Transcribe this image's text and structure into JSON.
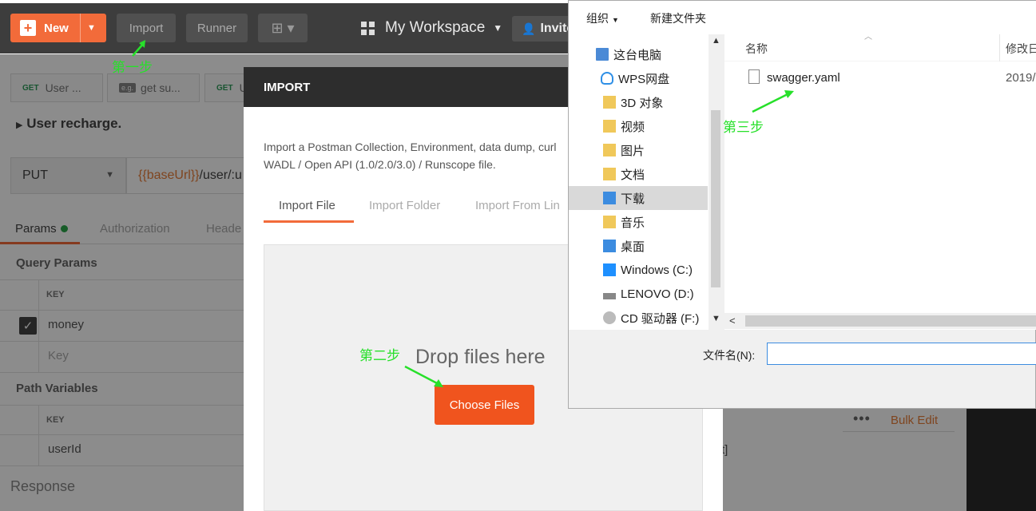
{
  "postman": {
    "new_label": "New",
    "import_label": "Import",
    "runner_label": "Runner",
    "workspace_label": "My Workspace",
    "invite_label": "Invite",
    "tabs": [
      {
        "method": "GET",
        "label": "User ..."
      },
      {
        "method": "e.g.",
        "label": "get su..."
      },
      {
        "method": "GET",
        "label": "U"
      }
    ],
    "request_name": "User recharge.",
    "method": "PUT",
    "url_var": "{{baseUrl}}",
    "url_rest": "/user/:u",
    "param_tabs": [
      "Params",
      "Authorization",
      "Heade"
    ],
    "query_params_title": "Query Params",
    "key_header": "KEY",
    "query_rows": [
      "money",
      "Key"
    ],
    "path_vars_title": "Path Variables",
    "path_rows": [
      "userId"
    ],
    "response_label": "Response",
    "bulk_edit": "Bulk Edit",
    "more_dots": "•••",
    "bracket_text": "t]"
  },
  "annotations": {
    "step1": "第一步",
    "step2": "第二步",
    "step3": "第三步"
  },
  "import_modal": {
    "title": "IMPORT",
    "description": "Import a Postman Collection, Environment, data dump, curl WADL / Open API (1.0/2.0/3.0) / Runscope file.",
    "tabs": [
      "Import File",
      "Import Folder",
      "Import From Lin"
    ],
    "drop_text": "Drop files here",
    "choose_label": "Choose Files"
  },
  "file_dialog": {
    "toolbar": {
      "organize": "组织",
      "new_folder": "新建文件夹"
    },
    "nav_items": [
      {
        "label": "这台电脑",
        "icon": "computer-icon"
      },
      {
        "label": "WPS网盘",
        "icon": "cloud-icon"
      },
      {
        "label": "3D 对象",
        "icon": "folder-icon"
      },
      {
        "label": "视频",
        "icon": "video-folder-icon"
      },
      {
        "label": "图片",
        "icon": "pictures-folder-icon"
      },
      {
        "label": "文档",
        "icon": "documents-folder-icon"
      },
      {
        "label": "下载",
        "icon": "downloads-folder-icon"
      },
      {
        "label": "音乐",
        "icon": "music-folder-icon"
      },
      {
        "label": "桌面",
        "icon": "desktop-folder-icon"
      },
      {
        "label": "Windows (C:)",
        "icon": "windows-drive-icon"
      },
      {
        "label": "LENOVO (D:)",
        "icon": "drive-icon"
      },
      {
        "label": "CD 驱动器 (F:)",
        "icon": "cd-drive-icon"
      }
    ],
    "selected_nav": "下载",
    "col_name": "名称",
    "col_modified": "修改日",
    "files": [
      {
        "name": "swagger.yaml",
        "date": "2019/"
      }
    ],
    "filename_label": "文件名(N):",
    "filename_value": ""
  },
  "colors": {
    "accent": "#f26b3a",
    "choose_btn": "#f0541e",
    "annotation": "#27e02a",
    "topbar": "#3d3d3d"
  }
}
